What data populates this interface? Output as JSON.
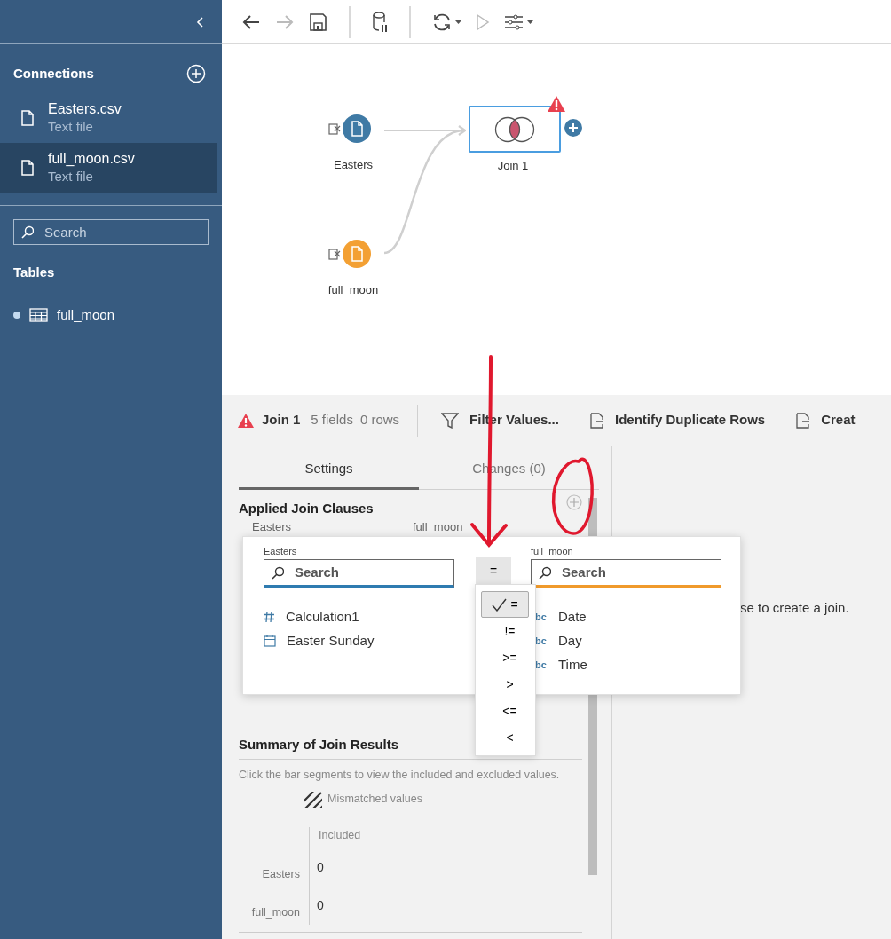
{
  "sidebar": {
    "connections_title": "Connections",
    "connections": [
      {
        "name": "Easters.csv",
        "type": "Text file",
        "selected": false
      },
      {
        "name": "full_moon.csv",
        "type": "Text file",
        "selected": true
      }
    ],
    "search": {
      "placeholder": "Search"
    },
    "tables_title": "Tables",
    "tables": [
      {
        "name": "full_moon"
      }
    ]
  },
  "toolbar": [
    {
      "kind": "back",
      "disabled": false
    },
    {
      "kind": "forward",
      "disabled": true
    },
    {
      "kind": "save",
      "disabled": false
    },
    {
      "kind": "separator"
    },
    {
      "kind": "pause-data",
      "disabled": false
    },
    {
      "kind": "separator"
    },
    {
      "kind": "refresh",
      "disabled": false
    },
    {
      "kind": "run",
      "disabled": true
    },
    {
      "kind": "options",
      "disabled": false
    }
  ],
  "flow": {
    "nodes": [
      {
        "kind": "input",
        "label": "Easters",
        "color": "#3f7aa5"
      },
      {
        "kind": "input",
        "label": "full_moon",
        "color": "#f3a033"
      },
      {
        "kind": "join",
        "label": "Join 1",
        "warning": true
      }
    ]
  },
  "step_header": {
    "title": "Join 1",
    "warning": true,
    "fields": "5 fields",
    "rows": "0 rows",
    "actions": [
      {
        "kind": "filter",
        "label": "Filter Values..."
      },
      {
        "kind": "document",
        "label": "Identify Duplicate Rows"
      },
      {
        "kind": "document",
        "label": "Creat"
      }
    ]
  },
  "settings_panel": {
    "tabs": [
      {
        "label": "Settings",
        "selected": true
      },
      {
        "label": "Changes (0)",
        "selected": false
      }
    ],
    "clauses_title": "Applied Join Clauses",
    "clause_columns": [
      "Easters",
      "full_moon"
    ],
    "summary_title": "Summary of Join Results",
    "summary_hint": "Click the bar segments to view the included and excluded values.",
    "legend": "Mismatched values",
    "table": {
      "columns": [
        "Included"
      ],
      "rows": [
        {
          "label": "Easters",
          "included": "0"
        },
        {
          "label": "full_moon",
          "included": "0"
        }
      ]
    }
  },
  "right_hint": "se to create a join.",
  "clause_editor": {
    "sides": [
      {
        "label": "Easters",
        "placeholder": "Search",
        "fields": [
          {
            "name": "Calculation1",
            "kind": "number"
          },
          {
            "name": "Easter Sunday",
            "kind": "date"
          }
        ]
      },
      {
        "label": "full_moon",
        "placeholder": "Search",
        "fields": [
          {
            "name": "Date",
            "kind": "string",
            "type_label": "bc"
          },
          {
            "name": "Day",
            "kind": "string",
            "type_label": "bc"
          },
          {
            "name": "Time",
            "kind": "string",
            "type_label": "bc"
          }
        ]
      }
    ],
    "operator": "=",
    "operators": [
      {
        "label": "=",
        "selected": true
      },
      {
        "label": "!=",
        "selected": false
      },
      {
        "label": ">=",
        "selected": false
      },
      {
        "label": ">",
        "selected": false
      },
      {
        "label": "<=",
        "selected": false
      },
      {
        "label": "<",
        "selected": false
      }
    ]
  }
}
